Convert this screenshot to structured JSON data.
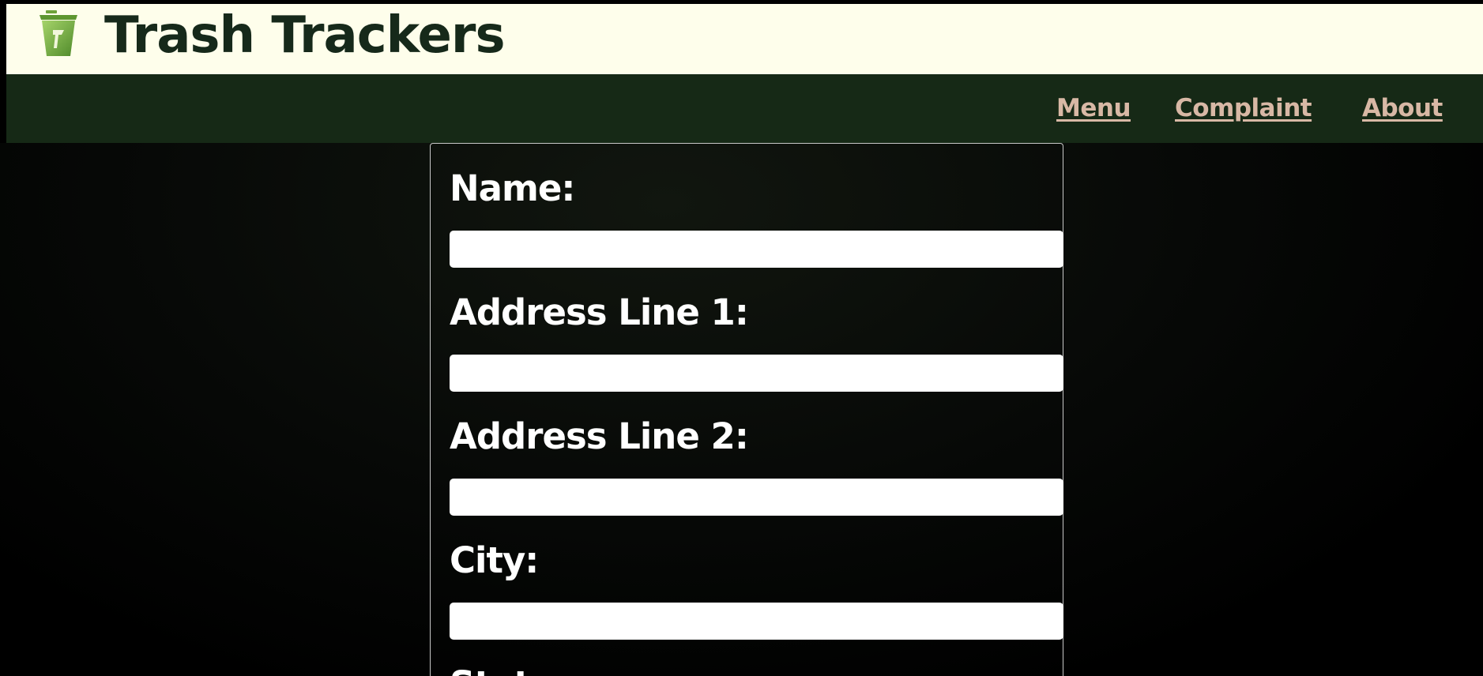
{
  "app": {
    "title": "Trash Trackers",
    "logo_icon": "trash-can-icon"
  },
  "nav": {
    "items": [
      {
        "label": "Menu"
      },
      {
        "label": "Complaint"
      },
      {
        "label": "About"
      }
    ]
  },
  "form": {
    "fields": [
      {
        "label": "Name:",
        "value": "",
        "placeholder": ""
      },
      {
        "label": "Address Line 1:",
        "value": "",
        "placeholder": ""
      },
      {
        "label": "Address Line 2:",
        "value": "",
        "placeholder": ""
      },
      {
        "label": "City:",
        "value": "",
        "placeholder": ""
      },
      {
        "label": "State:"
      }
    ]
  },
  "colors": {
    "header_bg": "#fefeeb",
    "title_text": "#16291a",
    "navbar_bg": "#162916",
    "nav_link": "#d8b8a5",
    "logo_green": "#7fb63a",
    "page_bg": "#000000"
  }
}
